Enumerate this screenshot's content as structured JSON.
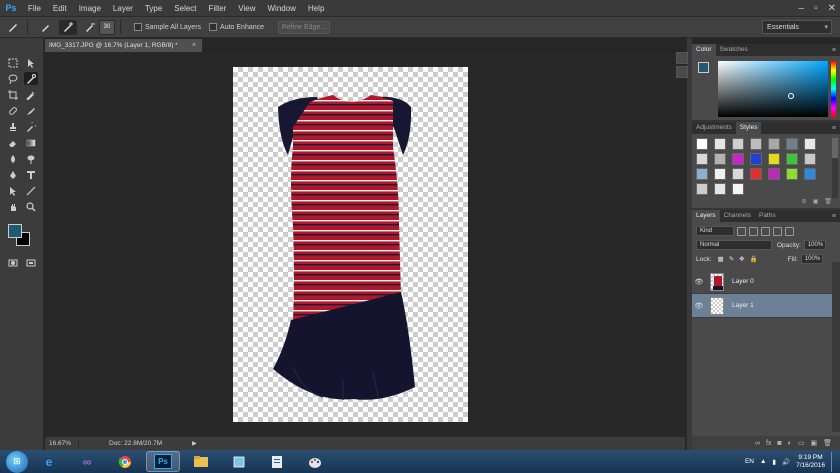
{
  "app": {
    "logo": "Ps"
  },
  "menu": [
    "File",
    "Edit",
    "Image",
    "Layer",
    "Type",
    "Select",
    "Filter",
    "View",
    "Window",
    "Help"
  ],
  "window_controls": [
    "minimize-icon",
    "maximize-icon",
    "close-icon"
  ],
  "options_bar": {
    "brush_size": "30",
    "sample_all_layers": "Sample All Layers",
    "auto_enhance": "Auto Enhance",
    "refine_edge": "Refine Edge...",
    "workspace": "Essentials"
  },
  "document": {
    "tab_title": "IMG_3317.JPG @ 16.7% (Layer 1, RGB/8) *",
    "close": "×",
    "zoom": "16.67%",
    "doc_size": "Doc: 22.8M/20.7M",
    "status_arrow": "▶"
  },
  "tools": [
    "move-tool",
    "marquee-tool",
    "lasso-tool",
    "quick-selection-tool",
    "crop-tool",
    "eyedropper-tool",
    "healing-brush-tool",
    "brush-tool",
    "clone-stamp-tool",
    "history-brush-tool",
    "eraser-tool",
    "gradient-tool",
    "blur-tool",
    "dodge-tool",
    "pen-tool",
    "type-tool",
    "path-selection-tool",
    "shape-tool",
    "hand-tool",
    "zoom-tool"
  ],
  "colors": {
    "foreground": "#1f5a72",
    "background": "#000000",
    "dress_red": "#b0182a",
    "dress_navy": "#14142e",
    "selected_layer": "#6d8196"
  },
  "color_panel": {
    "tabs": [
      "Color",
      "Swatches"
    ]
  },
  "styles_panel": {
    "tabs": [
      "Adjustments",
      "Styles"
    ],
    "swatches": [
      "#ffffff",
      "#e6e6e6",
      "#cfcfcf",
      "#bdbdbd",
      "#a8a8a8",
      "#6b7f8c",
      "#e8e8e8",
      "#d9d9d9",
      "#b3b3b3",
      "#c926c9",
      "#2040d8",
      "#e6d81a",
      "#3fc23f",
      "#c8c8c8",
      "#8ab0d0",
      "#f0f0f0",
      "#d8d8d8",
      "#e03030",
      "#c026c0",
      "#8ae02a",
      "#2a8ae0",
      "#ccc",
      "#e5e5e5",
      "#f5f5f5"
    ]
  },
  "layers_panel": {
    "tabs": [
      "Layers",
      "Channels",
      "Paths"
    ],
    "kind": "Kind",
    "blend_mode": "Normal",
    "opacity_label": "Opacity:",
    "opacity_value": "100%",
    "lock_label": "Lock:",
    "fill_label": "Fill:",
    "fill_value": "100%",
    "layers": [
      {
        "name": "Layer 0",
        "selected": false
      },
      {
        "name": "Layer 1",
        "selected": true
      }
    ],
    "footer_icons": [
      "link-icon",
      "fx-icon",
      "mask-icon",
      "adjustment-icon",
      "folder-icon",
      "new-layer-icon",
      "trash-icon"
    ]
  },
  "taskbar": {
    "start": "⊞",
    "apps": [
      "ie-icon",
      "visual-studio-icon",
      "chrome-icon",
      "photoshop-icon",
      "explorer-icon",
      "files-icon",
      "word-icon",
      "paint-icon"
    ],
    "ps_label": "Ps",
    "language": "EN",
    "time": "9:19 PM",
    "date": "7/16/2016"
  }
}
